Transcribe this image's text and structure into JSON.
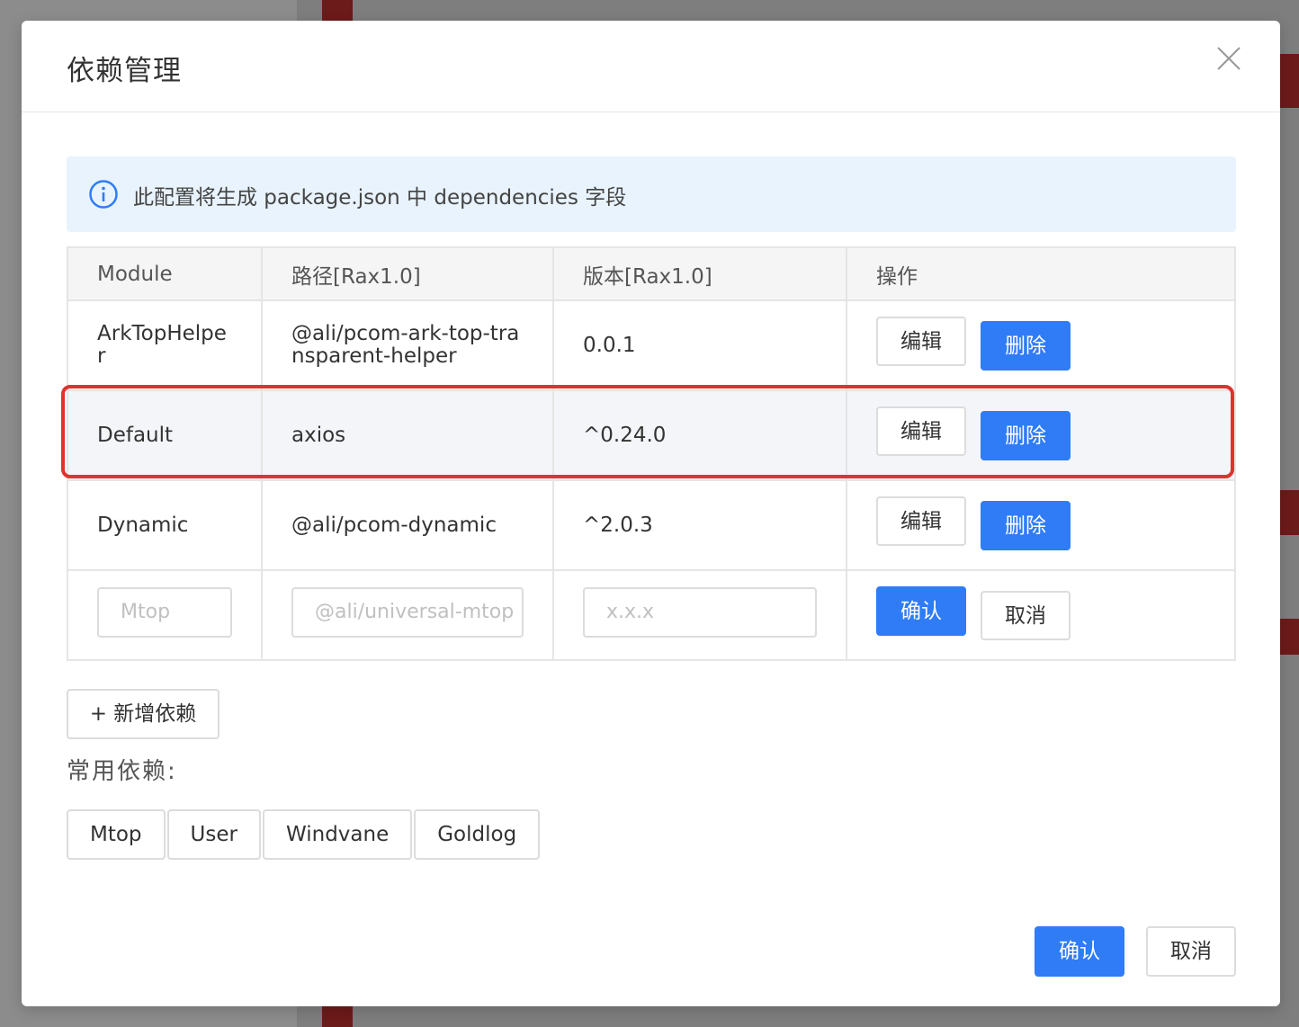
{
  "dialog": {
    "title": "依赖管理",
    "close_icon": "close-icon",
    "alert": {
      "icon": "info-icon",
      "text": "此配置将生成 package.json 中 dependencies 字段"
    }
  },
  "table": {
    "headers": [
      "Module",
      "路径[Rax1.0]",
      "版本[Rax1.0]",
      "操作"
    ],
    "rows": [
      {
        "module": "ArkTopHelper",
        "path": "@ali/pcom-ark-top-transparent-helper",
        "version": "0.0.1",
        "edit_label": "编辑",
        "delete_label": "删除"
      },
      {
        "module": "Default",
        "path": "axios",
        "version": "^0.24.0",
        "edit_label": "编辑",
        "delete_label": "删除"
      },
      {
        "module": "Dynamic",
        "path": "@ali/pcom-dynamic",
        "version": "^2.0.3",
        "edit_label": "编辑",
        "delete_label": "删除"
      }
    ],
    "new_row": {
      "module_placeholder": "Mtop",
      "path_placeholder": "@ali/universal-mtop",
      "version_placeholder": "x.x.x",
      "confirm_label": "确认",
      "cancel_label": "取消"
    }
  },
  "add_button": "+ 新增依赖",
  "common": {
    "label": "常用依赖:",
    "tags": [
      "Mtop",
      "User",
      "Windvane",
      "Goldlog"
    ]
  },
  "footer": {
    "ok_label": "确认",
    "cancel_label": "取消"
  },
  "colors": {
    "primary": "#2f7cf6",
    "highlight_border": "#e0322f",
    "alert_bg": "#e8f3fd"
  }
}
